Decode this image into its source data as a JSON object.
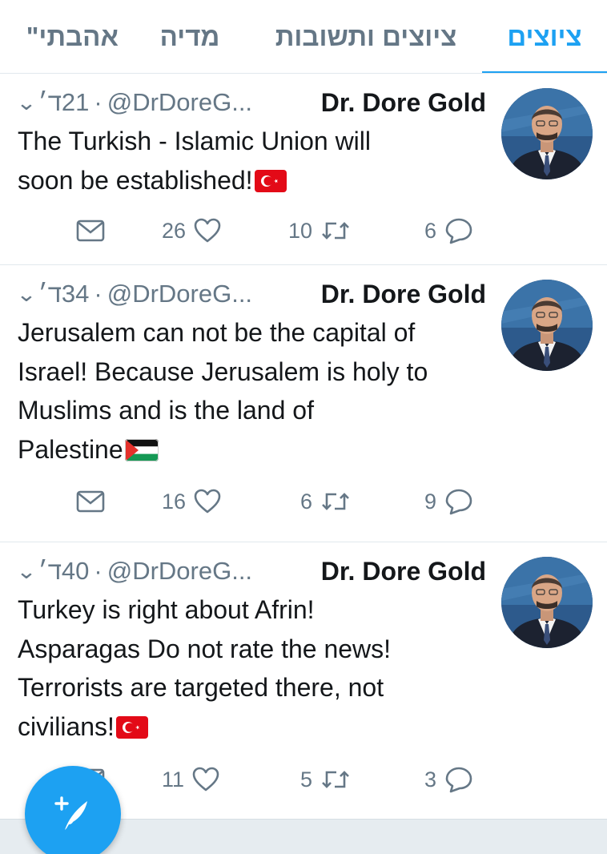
{
  "tabs": [
    {
      "label": "ציוצים",
      "active": true
    },
    {
      "label": "ציוצים ותשובות",
      "active": false
    },
    {
      "label": "מדיה",
      "active": false
    },
    {
      "label": "אהבתי\"",
      "active": false
    }
  ],
  "colors": {
    "accent": "#1da1f2",
    "muted": "#657786",
    "text": "#14171a",
    "divider": "#e1e8ed"
  },
  "tweets": [
    {
      "time": "‏21ד׳",
      "handle": "@DrDoreG...",
      "name": "Dr. Dore Gold",
      "lines": [
        "The Turkish - Islamic Union will",
        "soon be established!"
      ],
      "flag": "turkey-flag-icon",
      "likes": "26",
      "retweets": "10",
      "replies": "6"
    },
    {
      "time": "‏34ד׳",
      "handle": "@DrDoreG...",
      "name": "Dr. Dore Gold",
      "lines": [
        "Jerusalem can not be the capital of",
        "Israel! Because Jerusalem is holy to",
        "Muslims and is the land of",
        "Palestine"
      ],
      "flag": "palestine-flag-icon",
      "likes": "16",
      "retweets": "6",
      "replies": "9"
    },
    {
      "time": "‏40ד׳",
      "handle": "@DrDoreG...",
      "name": "Dr. Dore Gold",
      "lines": [
        "Turkey is right about Afrin!",
        "Asparagas Do not rate the news!",
        "Terrorists are targeted there, not",
        "civilians!"
      ],
      "flag": "turkey-flag-icon",
      "likes": "11",
      "retweets": "5",
      "replies": "3"
    }
  ],
  "header_separator": "·",
  "fab_icon": "compose-tweet-icon"
}
